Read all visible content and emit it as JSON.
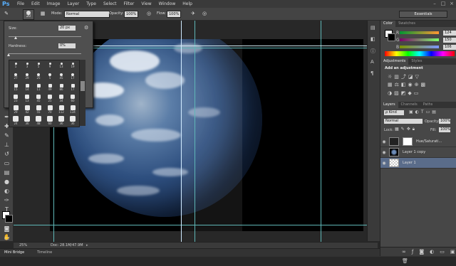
{
  "app": {
    "logo": "Ps"
  },
  "menu": [
    "File",
    "Edit",
    "Image",
    "Layer",
    "Type",
    "Select",
    "Filter",
    "View",
    "Window",
    "Help"
  ],
  "window_controls": [
    "–",
    "□",
    "×"
  ],
  "options": {
    "brush_size": "20",
    "mode_label": "Mode:",
    "mode_value": "Normal",
    "opacity_label": "Opacity:",
    "opacity_value": "100%",
    "flow_label": "Flow:",
    "flow_value": "100%",
    "workspace": "Essentials"
  },
  "brush_popup": {
    "size_label": "Size:",
    "size_value": "20 px",
    "hardness_label": "Hardness:",
    "hardness_value": "0%",
    "size_slider": 0.1,
    "hardness_slider": 0.0,
    "presets": [
      [
        "1",
        "3",
        "5",
        "9",
        "13",
        "19"
      ],
      [
        "27",
        "29",
        "25",
        "5",
        "45",
        "17"
      ],
      [
        "15",
        "14",
        "11",
        "49",
        "86",
        "17"
      ],
      [
        "23",
        "13",
        "45",
        "25",
        "34",
        "60"
      ],
      [
        "29",
        "42",
        "55",
        "70",
        "112",
        "134"
      ],
      [
        "24",
        "36",
        "48",
        "60",
        "36",
        "36"
      ]
    ]
  },
  "color_panel": {
    "tabs": [
      "Color",
      "Swatches"
    ],
    "channels": [
      {
        "name": "R",
        "value": "124"
      },
      {
        "name": "G",
        "value": "150"
      },
      {
        "name": "B",
        "value": "106"
      }
    ]
  },
  "adjust_panel": {
    "tabs": [
      "Adjustments",
      "Styles"
    ],
    "heading": "Add an adjustment"
  },
  "layers_panel": {
    "tabs": [
      "Layers",
      "Channels",
      "Paths"
    ],
    "filter": "Kind",
    "blend": "Normal",
    "opacity_label": "Opacity:",
    "opacity_value": "100%",
    "lock_label": "Lock:",
    "fill_label": "Fill:",
    "fill_value": "100%",
    "layers": [
      {
        "name": "Hue/Saturati...",
        "selected": false
      },
      {
        "name": "Layer 1 copy",
        "selected": false
      },
      {
        "name": "Layer 1",
        "selected": true
      }
    ]
  },
  "status": {
    "zoom": "25%",
    "doc": "Doc: 28.1M/47.9M"
  },
  "bottom_tabs": [
    "Mini Bridge",
    "Timeline"
  ]
}
